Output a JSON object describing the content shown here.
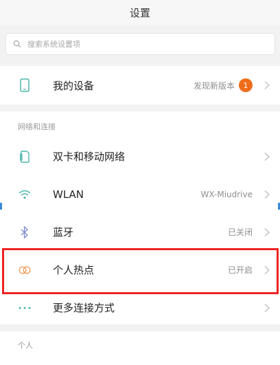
{
  "window": {
    "title": "设置"
  },
  "search": {
    "placeholder": "搜索系统设置项"
  },
  "device": {
    "label": "我的设备",
    "status": "发现新版本",
    "badge": "1"
  },
  "network_section": {
    "title": "网络和连接",
    "items": [
      {
        "label": "双卡和移动网络",
        "value": "",
        "icon": "sim-card-icon"
      },
      {
        "label": "WLAN",
        "value": "WX-Miudrive",
        "icon": "wifi-icon"
      },
      {
        "label": "蓝牙",
        "value": "已关闭",
        "icon": "bluetooth-icon"
      },
      {
        "label": "个人热点",
        "value": "已开启",
        "icon": "hotspot-icon"
      },
      {
        "label": "更多连接方式",
        "value": "",
        "icon": "more-dots-icon"
      }
    ]
  },
  "personal_section": {
    "title": "个人"
  },
  "colors": {
    "accent": "#4db6ac",
    "badge": "#ef6d1a",
    "highlight": "#ee2222",
    "hotspot": "#f0a060"
  }
}
